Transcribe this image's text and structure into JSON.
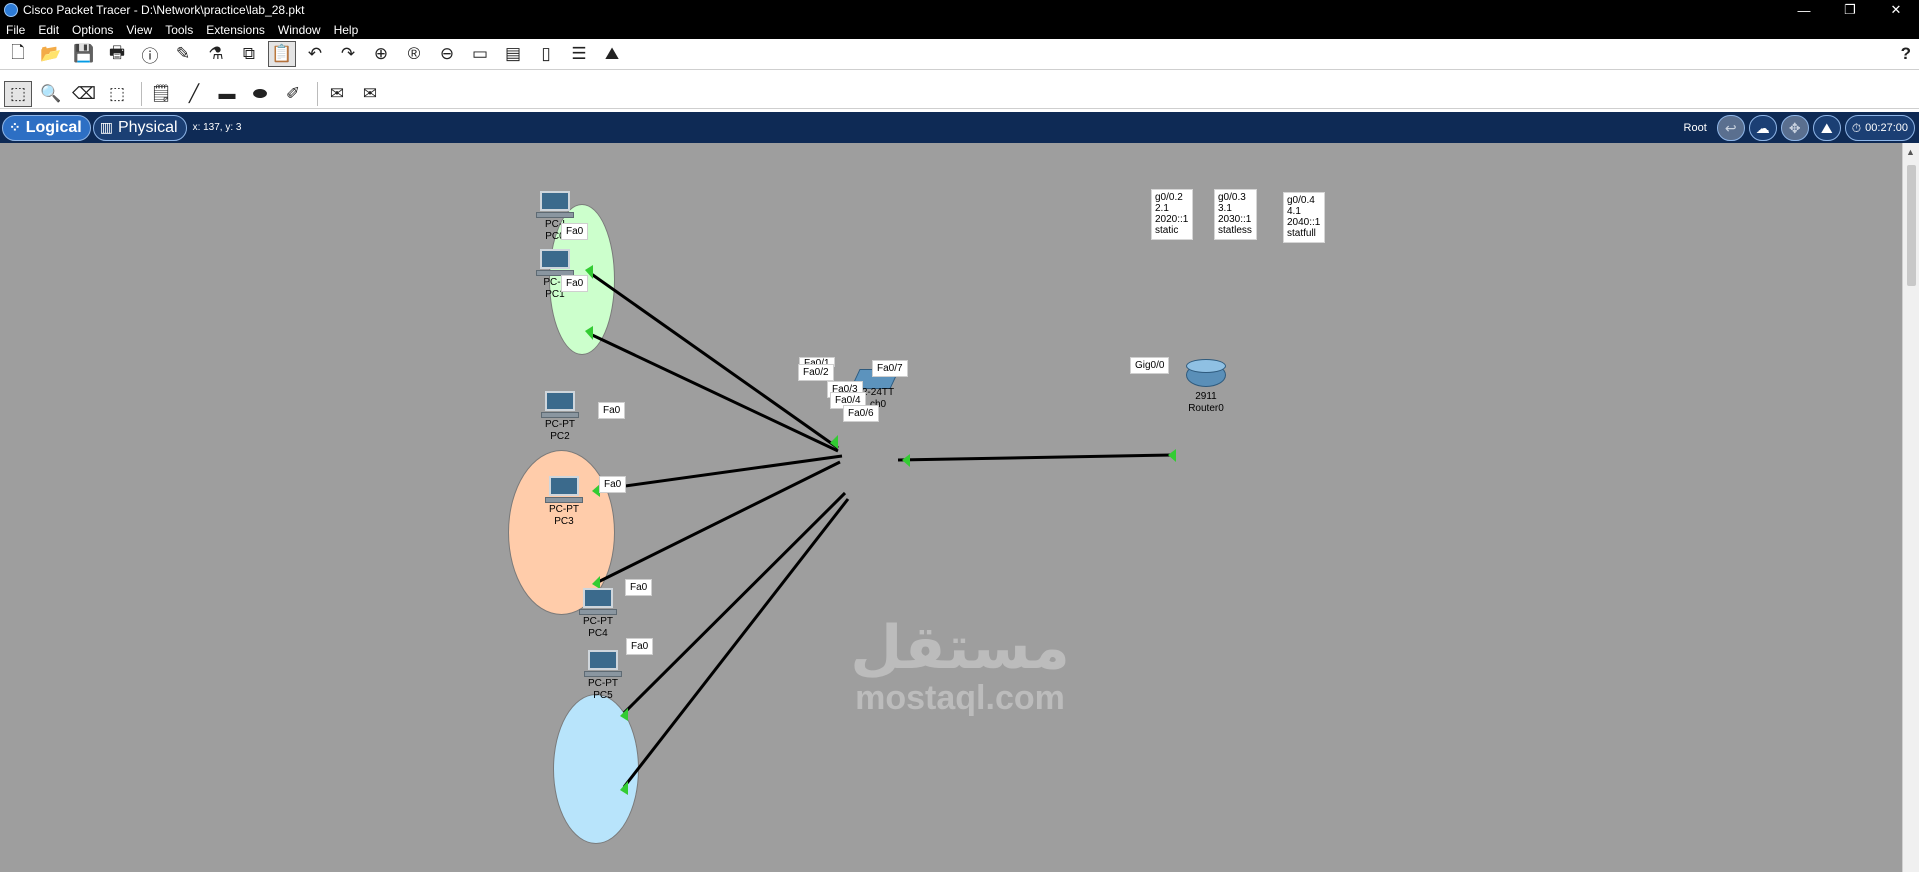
{
  "window": {
    "title": "Cisco Packet Tracer - D:\\Network\\practice\\lab_28.pkt",
    "controls": {
      "minimize": "—",
      "restore": "❐",
      "close": "✕"
    }
  },
  "menu": [
    "File",
    "Edit",
    "Options",
    "View",
    "Tools",
    "Extensions",
    "Window",
    "Help"
  ],
  "toolbar_main": {
    "buttons": [
      "new-file-icon",
      "open-folder-icon",
      "save-icon",
      "print-icon",
      "info-icon",
      "activity-wizard-icon",
      "custom-device-icon",
      "copy-icon",
      "paste-icon",
      "undo-icon",
      "redo-icon",
      "zoom-in-icon",
      "zoom-reset-icon",
      "zoom-out-icon",
      "drawing-palette-icon",
      "custom-devices-dialog-icon",
      "view-pdu-icon",
      "cluster-icon",
      "physical-workspace-icon"
    ],
    "help": "?"
  },
  "toolbar_edit": {
    "buttons": [
      "select-icon",
      "inspect-icon",
      "delete-icon",
      "resize-icon",
      "place-note-icon",
      "draw-line-icon",
      "draw-rectangle-icon",
      "draw-ellipse-icon",
      "freeform-icon",
      "add-simple-pdu-icon",
      "add-complex-pdu-icon"
    ]
  },
  "workspace": {
    "tabs": [
      {
        "label": "Logical",
        "active": true
      },
      {
        "label": "Physical",
        "active": false
      }
    ],
    "coords": "x: 137, y: 3",
    "root_label": "Root",
    "clock": "00:27:00"
  },
  "devices": {
    "pc0": {
      "model": "PC-I",
      "name": "PC0"
    },
    "pc1": {
      "model": "PC-F",
      "name": "PC1"
    },
    "pc2": {
      "model": "PC-PT",
      "name": "PC2"
    },
    "pc3": {
      "model": "PC-PT",
      "name": "PC3"
    },
    "pc4": {
      "model": "PC-PT",
      "name": "PC4"
    },
    "pc5": {
      "model": "PC-PT",
      "name": "PC5"
    },
    "switch0": {
      "model": "2-24TT",
      "name": "ch0"
    },
    "router0": {
      "model": "2911",
      "name": "Router0"
    }
  },
  "port_labels": {
    "pc0_fa0": "Fa0",
    "pc1_fa0": "Fa0",
    "pc2_fa0": "Fa0",
    "pc3_fa0": "Fa0",
    "pc4_fa0": "Fa0",
    "pc5_fa0": "Fa0",
    "sw_fa01": "Fa0/1",
    "sw_fa02": "Fa0/2",
    "sw_fa03": "Fa0/3",
    "sw_fa04": "Fa0/4",
    "sw_fa06": "Fa0/6",
    "sw_fa07": "Fa0/7",
    "router_gig00": "Gig0/0"
  },
  "notes": {
    "note1": "g0/0.2\n2.1\n2020::1\nstatic",
    "note2": "g0/0.3\n3.1\n2030::1\nstatless",
    "note3": "g0/0.4\n4.1\n2040::1\nstatfull"
  },
  "watermark": {
    "arabic": "مستقل",
    "latin": "mostaql.com"
  },
  "colors": {
    "titlebar": "#000000",
    "workspace_bar": "#0e2a55",
    "canvas": "#9e9e9e",
    "vlan_green": "#ccffcc",
    "vlan_orange": "#ffccaa",
    "vlan_blue": "#b8e4fb",
    "link": "#000000",
    "link_up": "#33cc33"
  }
}
